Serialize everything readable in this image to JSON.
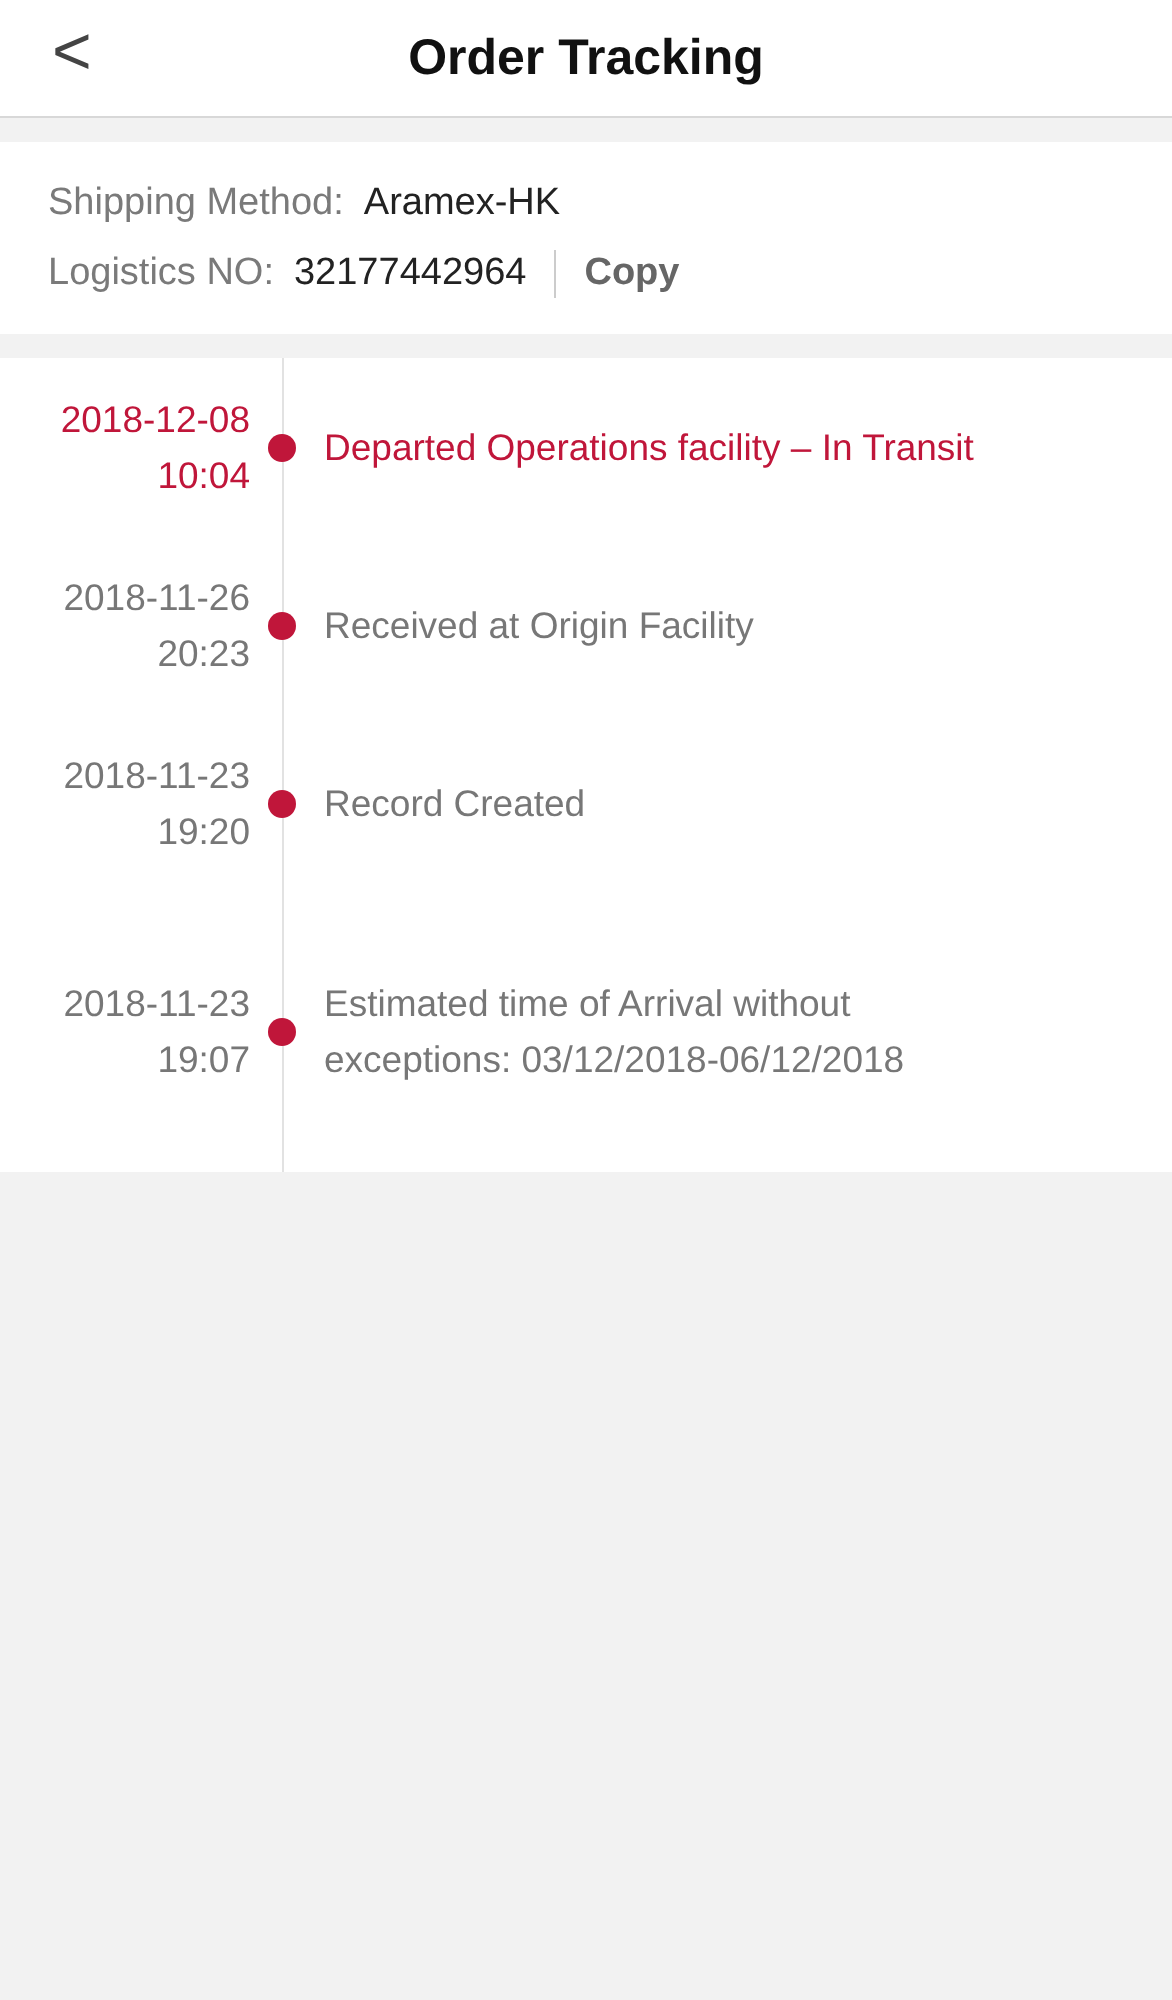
{
  "header": {
    "back": "<",
    "title": "Order Tracking"
  },
  "shipping": {
    "method_label": "Shipping Method:",
    "method": "Aramex-HK",
    "number_label": "Logistics NO:",
    "number": "32177442964",
    "copy": "Copy"
  },
  "events": [
    {
      "date": "2018-12-08",
      "time": "10:04",
      "text": "Departed Operations facility – In Transit",
      "current": true
    },
    {
      "date": "2018-11-26",
      "time": "20:23",
      "text": "Received at Origin Facility",
      "current": false
    },
    {
      "date": "2018-11-23",
      "time": "19:20",
      "text": "Record Created",
      "current": false
    },
    {
      "date": "2018-11-23",
      "time": "19:07",
      "text": "Estimated time of Arrival without exceptions: 03/12/2018-06/12/2018",
      "current": false
    }
  ]
}
